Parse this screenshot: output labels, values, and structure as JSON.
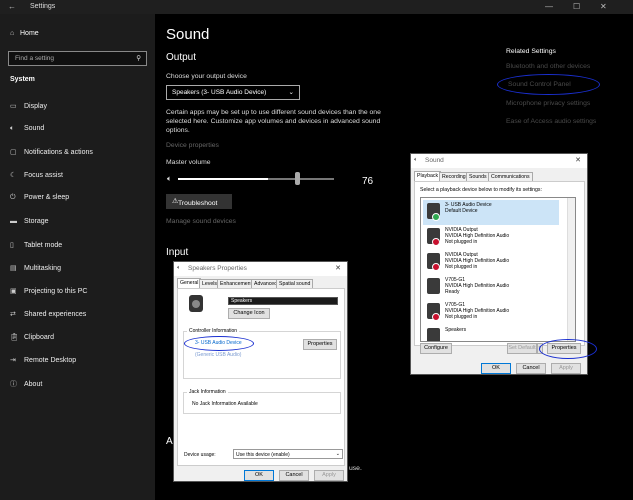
{
  "titlebar": {
    "title": "Settings",
    "back": "←",
    "min": "—",
    "max": "☐",
    "close": "✕"
  },
  "sidebar": {
    "home": "Home",
    "search_placeholder": "Find a setting",
    "section": "System",
    "items": [
      "Display",
      "Sound",
      "Notifications & actions",
      "Focus assist",
      "Power & sleep",
      "Storage",
      "Tablet mode",
      "Multitasking",
      "Projecting to this PC",
      "Shared experiences",
      "Clipboard",
      "Remote Desktop",
      "About"
    ],
    "icons": [
      "display-icon",
      "speaker-icon",
      "notifications-icon",
      "focus-assist-icon",
      "power-icon",
      "storage-icon",
      "tablet-icon",
      "multitasking-icon",
      "projecting-icon",
      "shared-experiences-icon",
      "clipboard-icon",
      "remote-desktop-icon",
      "about-icon"
    ]
  },
  "main": {
    "title": "Sound",
    "output_heading": "Output",
    "choose_label": "Choose your output device",
    "output_device": "Speakers (3- USB Audio Device)",
    "info": [
      "Certain apps may be set up to use different sound devices than the one",
      "selected here. Customize app volumes and devices in advanced sound",
      "options."
    ],
    "device_properties": "Device properties",
    "master_volume": "Master volume",
    "volume": 76,
    "troubleshoot": "Troubleshoot",
    "manage_devices": "Manage sound devices",
    "input_heading": "Input",
    "partial_a": "A",
    "partial_use": "use."
  },
  "related": {
    "heading": "Related Settings",
    "links": [
      "Bluetooth and other devices",
      "Sound Control Panel",
      "Microphone privacy settings",
      "Ease of Access audio settings"
    ]
  },
  "sound_dialog": {
    "title": "Sound",
    "tabs": [
      "Playback",
      "Recording",
      "Sounds",
      "Communications"
    ],
    "instruction": "Select a playback device below to modify its settings:",
    "devices": [
      {
        "l1": "3- USB Audio Device",
        "l2": "Default Device",
        "l3": "",
        "status": "default"
      },
      {
        "l1": "NVIDIA Output",
        "l2": "NVIDIA High Definition Audio",
        "l3": "Not plugged in",
        "status": "unplugged"
      },
      {
        "l1": "NVIDIA Output",
        "l2": "NVIDIA High Definition Audio",
        "l3": "Not plugged in",
        "status": "unplugged"
      },
      {
        "l1": "V705-G1",
        "l2": "NVIDIA High Definition Audio",
        "l3": "Ready",
        "status": "ready"
      },
      {
        "l1": "V705-G1",
        "l2": "NVIDIA High Definition Audio",
        "l3": "Not plugged in",
        "status": "unplugged"
      },
      {
        "l1": "Speakers",
        "l2": "",
        "l3": "",
        "status": "none"
      }
    ],
    "configure": "Configure",
    "set_default": "Set Default",
    "properties": "Properties",
    "ok": "OK",
    "cancel": "Cancel",
    "apply": "Apply"
  },
  "speakers_dialog": {
    "title": "Speakers Properties",
    "tabs": [
      "General",
      "Levels",
      "Enhancements",
      "Advanced",
      "Spatial sound"
    ],
    "name_value": "Speakers",
    "change_icon": "Change Icon",
    "controller_label": "Controller Information",
    "controller_name": "3- USB Audio Device",
    "controller_sub": "(Generic USB Audio)",
    "properties": "Properties",
    "jack_label": "Jack Information",
    "jack_value": "No Jack Information Available",
    "usage_label": "Device usage:",
    "usage_value": "Use this device (enable)",
    "ok": "OK",
    "cancel": "Cancel",
    "apply": "Apply"
  },
  "colors": {
    "annotation": "#1a2fd0",
    "accent": "#0078d7"
  }
}
